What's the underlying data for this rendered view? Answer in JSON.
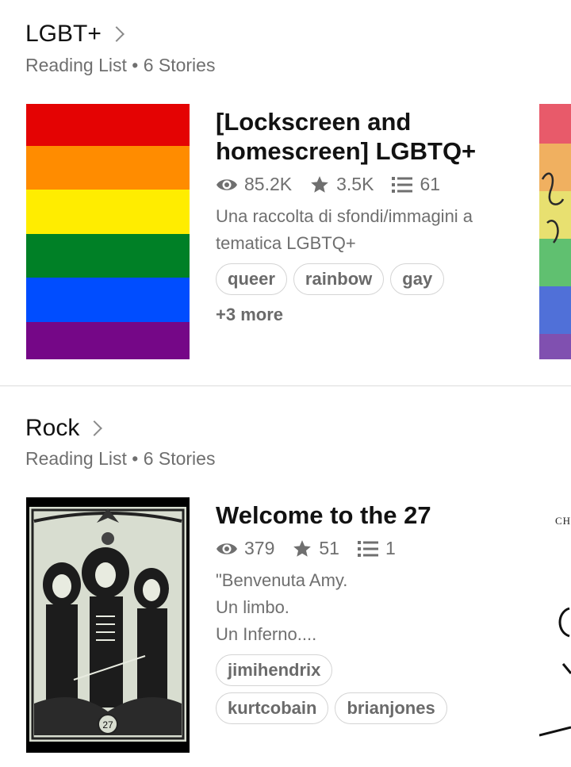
{
  "sections": [
    {
      "title": "LGBT+",
      "subtitle": "Reading List • 6 Stories",
      "story": {
        "title": "[Lockscreen and homescreen] LGBTQ+",
        "views": "85.2K",
        "votes": "3.5K",
        "parts": "61",
        "description": "Una raccolta di sfondi/immagini a tematica LGBTQ+",
        "tags": [
          "queer",
          "rainbow",
          "gay"
        ],
        "more": "+3 more",
        "flag_colors": [
          "#e40303",
          "#ff8c00",
          "#ffed00",
          "#008026",
          "#004dff",
          "#750787"
        ]
      }
    },
    {
      "title": "Rock",
      "subtitle": "Reading List • 6 Stories",
      "story": {
        "title": "Welcome to the 27",
        "views": "379",
        "votes": "51",
        "parts": "1",
        "description_lines": [
          "\"Benvenuta Amy.",
          "Un limbo.",
          "Un Inferno...."
        ],
        "tags": [
          "jimihendrix",
          "kurtcobain",
          "brianjones"
        ],
        "cover_text": "27"
      },
      "peek_text": "CH"
    }
  ],
  "icons": {
    "views": "eye-icon",
    "votes": "star-icon",
    "parts": "list-icon",
    "more": "chevron-right-icon"
  }
}
